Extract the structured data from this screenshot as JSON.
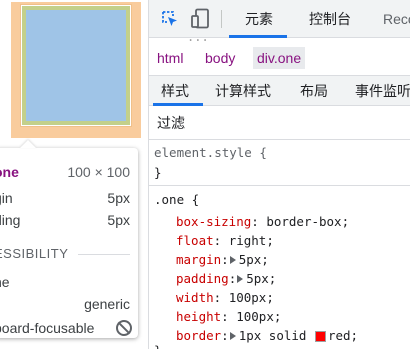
{
  "tooltip": {
    "element_name": "one",
    "dimensions": "100 × 100",
    "margin_label": "gin",
    "margin_value": "5px",
    "padding_label": "ding",
    "padding_value": "5px",
    "accessibility_heading": "ESSIBILITY",
    "name_label": "ne",
    "role_value": "generic",
    "keyboard_label": "board-focusable"
  },
  "toolbar": {
    "tabs": [
      "元素",
      "控制台",
      "Reco"
    ],
    "inspect_icon": "inspect-icon",
    "device_icon": "device-toggle-icon",
    "accent": "#1a73e8"
  },
  "breadcrumbs": {
    "cut_text": "...",
    "items": [
      "html",
      "body",
      "div.one"
    ]
  },
  "styles_tabs": [
    "样式",
    "计算样式",
    "布局",
    "事件监听"
  ],
  "filter": {
    "placeholder": "过滤"
  },
  "element_style": {
    "selector": "element.style {",
    "close": "}"
  },
  "rule": {
    "selector": ".one {",
    "declarations": [
      {
        "prop": "box-sizing",
        "value": "border-box;"
      },
      {
        "prop": "float",
        "value": "right;"
      },
      {
        "prop": "margin",
        "value": "5px;"
      },
      {
        "prop": "padding",
        "value": "5px;"
      },
      {
        "prop": "width",
        "value": "100px;"
      },
      {
        "prop": "height",
        "value": "100px;"
      },
      {
        "prop": "border",
        "value": "1px solid",
        "color_value": "red;",
        "color": "#ff0000"
      }
    ],
    "close": "}"
  },
  "box_colors": {
    "margin": "#f9cc9d",
    "padding": "#c3d08b",
    "content": "#9fc4e7"
  }
}
